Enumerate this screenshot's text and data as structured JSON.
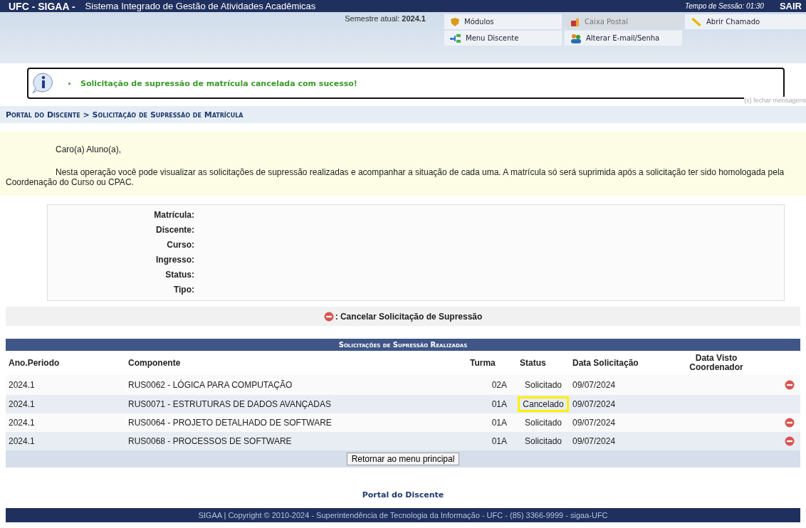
{
  "top_bar": {
    "brand": "UFC - SIGAA -",
    "system_name": "Sistema Integrado de Gestão de Atividades Acadêmicas",
    "session": "Tempo de Sessão: 01:30",
    "logout": "SAIR"
  },
  "header": {
    "semester_label": "Semestre atual:",
    "semester": "2024.1",
    "menu": [
      {
        "label": "Módulos",
        "kind": "modules",
        "disabled": false
      },
      {
        "label": "Caixa Postal",
        "kind": "mailbox",
        "disabled": true
      },
      {
        "label": "Abrir Chamado",
        "kind": "ticket",
        "disabled": false
      },
      {
        "label": "Menu Discente",
        "kind": "menu",
        "disabled": false
      },
      {
        "label": "Alterar E-mail/Senha",
        "kind": "account",
        "disabled": false
      }
    ]
  },
  "message": {
    "text": "Solicitação de supressão de matrícula cancelada com sucesso!",
    "close": "(x) fechar mensagens"
  },
  "breadcrumb": "Portal do Discente > Solicitação de Supressão de Matrícula",
  "intro": {
    "greeting": "Caro(a) Aluno(a),",
    "text": "Nesta operação você pode visualizar as solicitações de supressão realizadas e acompanhar a situação de cada uma. A matrícula só será suprimida após a solicitação ter sido homologada pela Coordenação do Curso ou CPAC."
  },
  "student_info": {
    "fields": [
      "Matrícula:",
      "Discente:",
      "Curso:",
      "Ingresso:",
      "Status:",
      "Tipo:"
    ]
  },
  "legend": ": Cancelar Solicitação de Supressão",
  "table": {
    "title": "Solicitações de Supressão Realizadas",
    "columns": [
      "Ano.Periodo",
      "Componente",
      "Turma",
      "Status",
      "Data Solicitação",
      "Data Visto Coordenador"
    ],
    "rows": [
      {
        "period": "2024.1",
        "component": "RUS0062 - LÓGICA PARA COMPUTAÇÃO",
        "class": "02A",
        "status": "Solicitado",
        "date": "09/07/2024",
        "highlighted": false,
        "cancelable": true
      },
      {
        "period": "2024.1",
        "component": "RUS0071 - ESTRUTURAS DE DADOS AVANÇADAS",
        "class": "01A",
        "status": "Cancelado",
        "date": "09/07/2024",
        "highlighted": true,
        "cancelable": false
      },
      {
        "period": "2024.1",
        "component": "RUS0064 - PROJETO DETALHADO DE SOFTWARE",
        "class": "01A",
        "status": "Solicitado",
        "date": "09/07/2024",
        "highlighted": false,
        "cancelable": true
      },
      {
        "period": "2024.1",
        "component": "RUS0068 - PROCESSOS DE SOFTWARE",
        "class": "01A",
        "status": "Solicitado",
        "date": "09/07/2024",
        "highlighted": false,
        "cancelable": true
      }
    ],
    "back_button": "Retornar ao menu principal"
  },
  "footer_link": "Portal do Discente",
  "footer": "SIGAA | Copyright © 2010-2024 - Superintendência de Tecnologia da Informação - UFC - (85) 3366-9999 - sigaa-UFC"
}
